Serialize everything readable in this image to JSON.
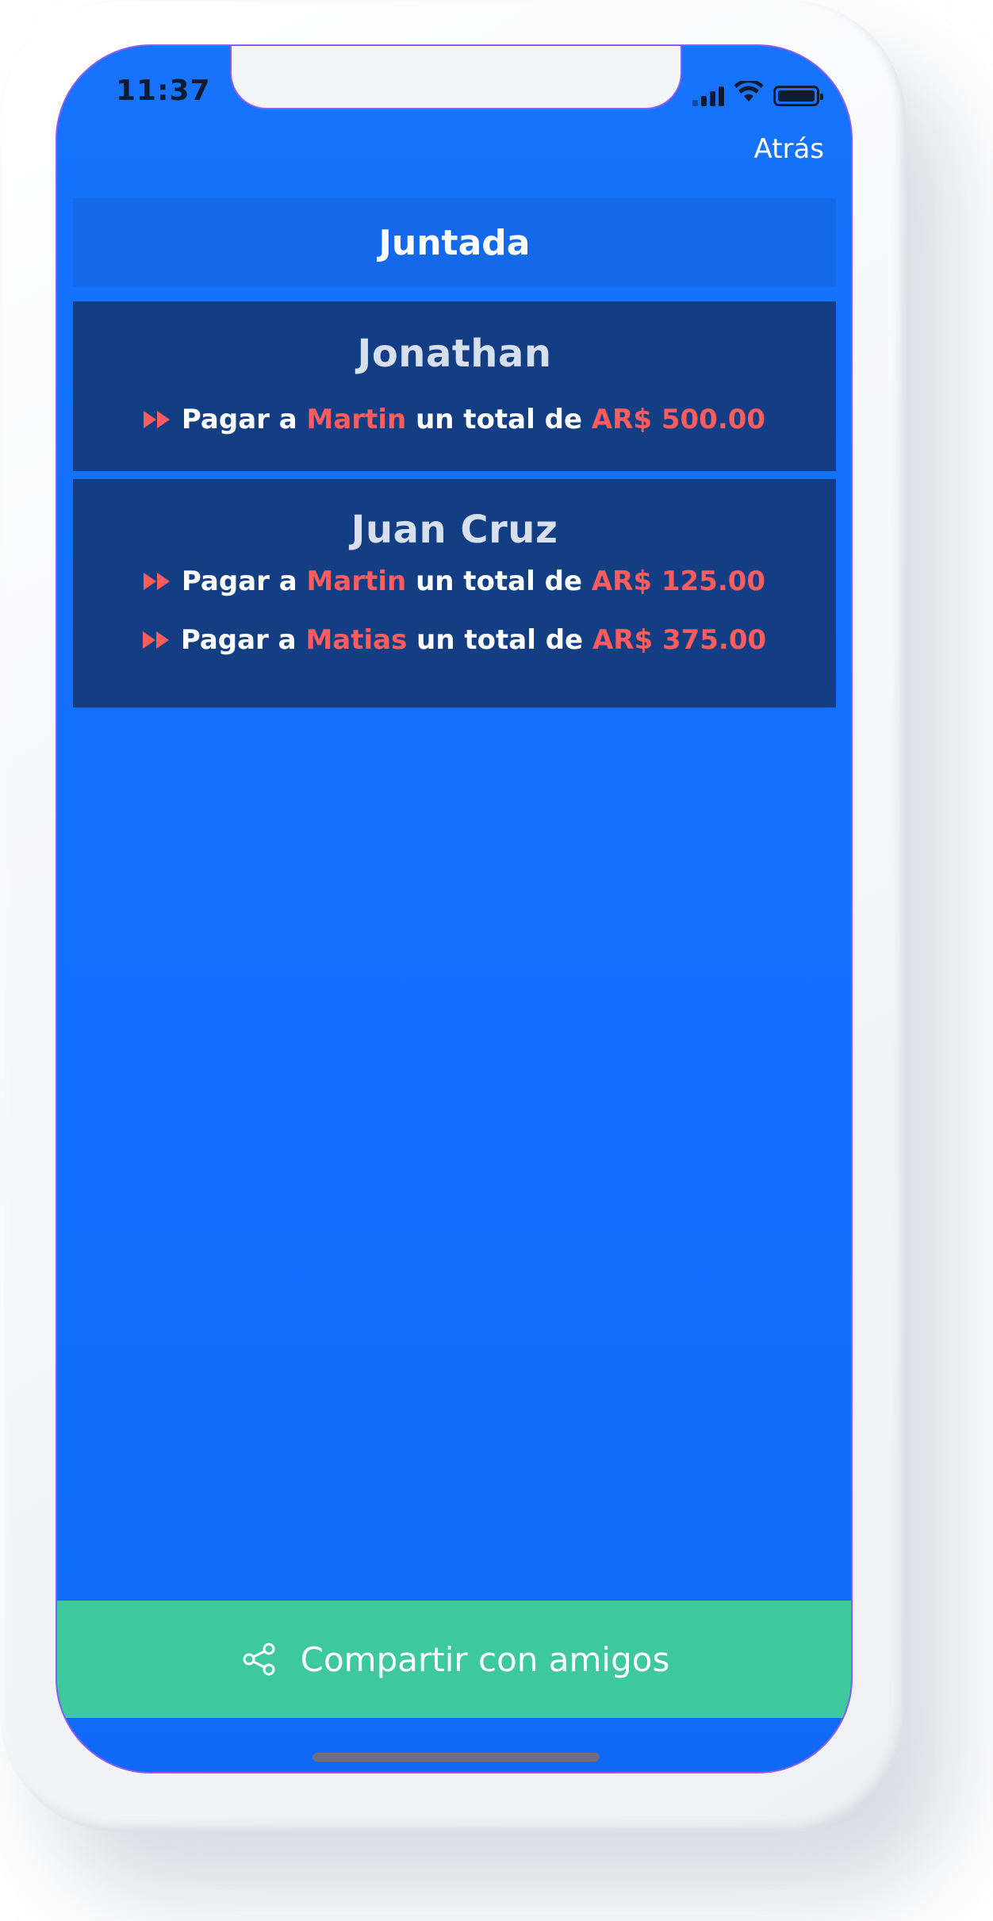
{
  "status_bar": {
    "time": "11:37"
  },
  "nav": {
    "back_label": "Atrás"
  },
  "header": {
    "title": "Juntada"
  },
  "people": [
    {
      "name": "Jonathan",
      "payments": [
        {
          "prefix": "Pagar a",
          "to": "Martin",
          "middle": "un total de",
          "amount": "AR$ 500.00"
        }
      ]
    },
    {
      "name": "Juan Cruz",
      "payments": [
        {
          "prefix": "Pagar a",
          "to": "Martin",
          "middle": "un total de",
          "amount": "AR$ 125.00"
        },
        {
          "prefix": "Pagar a",
          "to": "Matias",
          "middle": "un total de",
          "amount": "AR$ 375.00"
        }
      ]
    }
  ],
  "footer": {
    "share_label": "Compartir con amigos"
  },
  "colors": {
    "background": "#126ffd",
    "card": "#133e84",
    "accent_red": "#ff5d5d",
    "share_green": "#3dc99c"
  },
  "icons": [
    "cellular-signal-icon",
    "wifi-icon",
    "battery-icon",
    "fast-forward-icon",
    "share-icon"
  ]
}
